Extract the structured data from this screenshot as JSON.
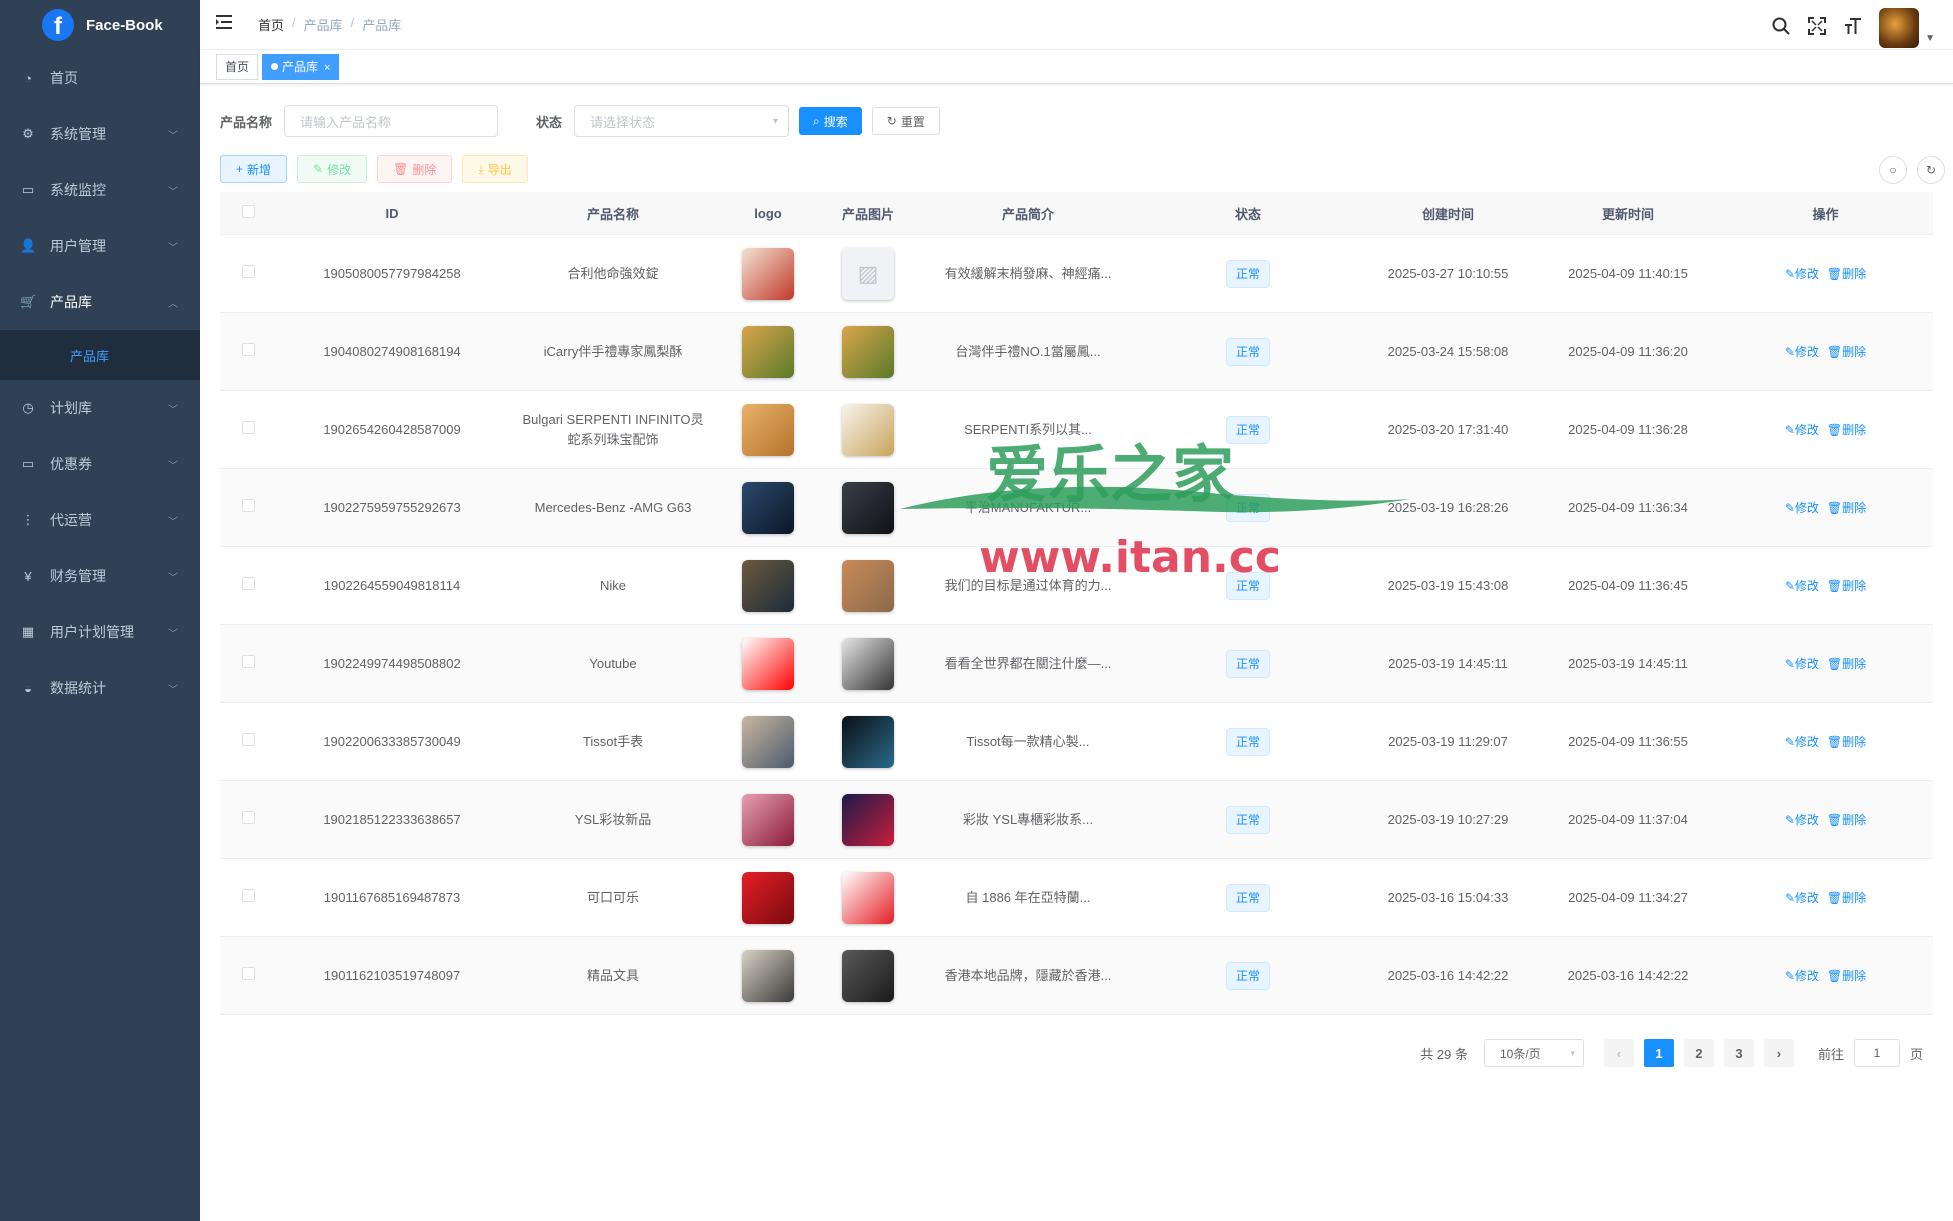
{
  "app": {
    "title": "Face-Book"
  },
  "sidebar": {
    "items": [
      {
        "label": "首页",
        "icon": "dashboard-icon"
      },
      {
        "label": "系统管理",
        "icon": "gear-icon"
      },
      {
        "label": "系统监控",
        "icon": "monitor-icon"
      },
      {
        "label": "用户管理",
        "icon": "users-icon"
      },
      {
        "label": "产品库",
        "icon": "cart-icon"
      },
      {
        "label": "计划库",
        "icon": "clock-icon"
      },
      {
        "label": "优惠券",
        "icon": "coupon-icon"
      },
      {
        "label": "代运营",
        "icon": "tree-icon"
      },
      {
        "label": "财务管理",
        "icon": "yen-icon"
      },
      {
        "label": "用户计划管理",
        "icon": "table-icon"
      },
      {
        "label": "数据统计",
        "icon": "chart-icon"
      }
    ],
    "sub_active": "产品库"
  },
  "breadcrumb": [
    "首页",
    "产品库",
    "产品库"
  ],
  "tags": [
    "首页",
    "产品库"
  ],
  "search": {
    "name_label": "产品名称",
    "name_placeholder": "请输入产品名称",
    "status_label": "状态",
    "status_placeholder": "请选择状态",
    "search_btn": "搜索",
    "reset_btn": "重置"
  },
  "toolbar": {
    "add": "新增",
    "edit": "修改",
    "delete": "删除",
    "export": "导出"
  },
  "table": {
    "headers": [
      "ID",
      "产品名称",
      "logo",
      "产品图片",
      "产品简介",
      "状态",
      "创建时间",
      "更新时间",
      "操作"
    ],
    "edit_label": "修改",
    "delete_label": "删除",
    "rows": [
      {
        "id": "1905080057797984258",
        "name": "合利他命強效錠",
        "desc": "有效緩解末梢發麻、神經痛...",
        "status": "正常",
        "created": "2025-03-27 10:10:55",
        "updated": "2025-04-09 11:40:15",
        "logo_colors": [
          "#f3e3d3",
          "#c0392b"
        ],
        "img_colors": [
          "#eef1f6",
          "#c0c4cc"
        ]
      },
      {
        "id": "1904080274908168194",
        "name": "iCarry伴手禮專家鳳梨酥",
        "desc": "台灣伴手禮NO.1當屬鳳...",
        "status": "正常",
        "created": "2025-03-24 15:58:08",
        "updated": "2025-04-09 11:36:20",
        "logo_colors": [
          "#d9a54a",
          "#5a7a2b"
        ],
        "img_colors": [
          "#d9a54a",
          "#5a7a2b"
        ]
      },
      {
        "id": "1902654260428587009",
        "name": "Bulgari SERPENTI INFINITO灵蛇系列珠宝配饰",
        "desc": "SERPENTI系列以其...",
        "status": "正常",
        "created": "2025-03-20 17:31:40",
        "updated": "2025-04-09 11:36:28",
        "logo_colors": [
          "#e8b26a",
          "#b5722a"
        ],
        "img_colors": [
          "#f7f4ee",
          "#c9a45b"
        ]
      },
      {
        "id": "1902275959755292673",
        "name": "Mercedes-Benz -AMG G63",
        "desc": "平治MANUFAKTUR...",
        "status": "正常",
        "created": "2025-03-19 16:28:26",
        "updated": "2025-04-09 11:36:34",
        "logo_colors": [
          "#2c4a6e",
          "#0b1626"
        ],
        "img_colors": [
          "#3a3f47",
          "#0f1115"
        ]
      },
      {
        "id": "1902264559049818114",
        "name": "Nike",
        "desc": "我们的目标是通过体育的力...",
        "status": "正常",
        "created": "2025-03-19 15:43:08",
        "updated": "2025-04-09 11:36:45",
        "logo_colors": [
          "#6b5a3e",
          "#1c2a3a"
        ],
        "img_colors": [
          "#c98a5a",
          "#8a6a4a"
        ]
      },
      {
        "id": "1902249974498508802",
        "name": "Youtube",
        "desc": "看看全世界都在關注什麼—...",
        "status": "正常",
        "created": "2025-03-19 14:45:11",
        "updated": "2025-03-19 14:45:11",
        "logo_colors": [
          "#ffffff",
          "#ff0000"
        ],
        "img_colors": [
          "#e6e6e6",
          "#333333"
        ]
      },
      {
        "id": "1902200633385730049",
        "name": "Tissot手表",
        "desc": "Tissot每一款精心製...",
        "status": "正常",
        "created": "2025-03-19 11:29:07",
        "updated": "2025-04-09 11:36:55",
        "logo_colors": [
          "#c9b8a0",
          "#4b5a6e"
        ],
        "img_colors": [
          "#0b0f14",
          "#2a6a8a"
        ]
      },
      {
        "id": "1902185122333638657",
        "name": "YSL彩妆新品",
        "desc": "彩妝 YSL專櫃彩妝系...",
        "status": "正常",
        "created": "2025-03-19 10:27:29",
        "updated": "2025-04-09 11:37:04",
        "logo_colors": [
          "#e6a0b0",
          "#8a1a3a"
        ],
        "img_colors": [
          "#1a1a4a",
          "#c81e3a"
        ]
      },
      {
        "id": "1901167685169487873",
        "name": "可口可乐",
        "desc": "自 1886 年在亞特蘭...",
        "status": "正常",
        "created": "2025-03-16 15:04:33",
        "updated": "2025-04-09 11:34:27",
        "logo_colors": [
          "#e41e26",
          "#7a0a10"
        ],
        "img_colors": [
          "#ffffff",
          "#e41e26"
        ]
      },
      {
        "id": "1901162103519748097",
        "name": "精品文具",
        "desc": "香港本地品牌，隱藏於香港...",
        "status": "正常",
        "created": "2025-03-16 14:42:22",
        "updated": "2025-03-16 14:42:22",
        "logo_colors": [
          "#d8d2c4",
          "#3a3a3a"
        ],
        "img_colors": [
          "#5a5a5a",
          "#1a1a1a"
        ]
      }
    ]
  },
  "pagination": {
    "total_text": "共 29 条",
    "page_size": "10条/页",
    "pages": [
      "1",
      "2",
      "3"
    ],
    "current": "1",
    "goto_label": "前往",
    "goto_value": "1",
    "page_unit": "页"
  },
  "watermark": {
    "line1": "爱乐之家",
    "line2": "www.itan.cc",
    "color1": "#2e9e5b",
    "color2": "#e0304a"
  }
}
